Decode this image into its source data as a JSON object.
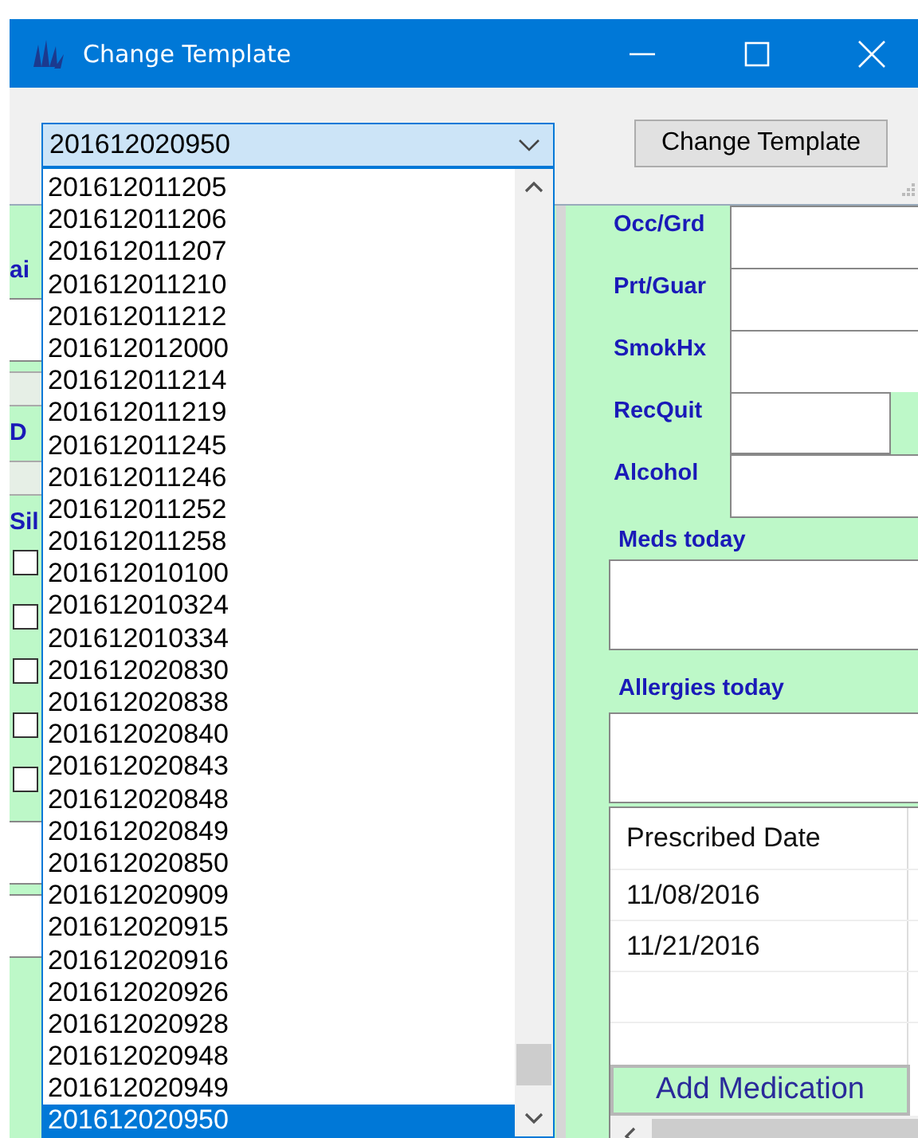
{
  "window": {
    "title": "Change Template"
  },
  "toolbar": {
    "template_select": {
      "value": "201612020950",
      "expanded": true
    },
    "change_button": "Change Template"
  },
  "dropdown_list": {
    "items": [
      {
        "label": "201612011205",
        "selected": false
      },
      {
        "label": "201612011206",
        "selected": false
      },
      {
        "label": "201612011207",
        "selected": false
      },
      {
        "label": "201612011210",
        "selected": false
      },
      {
        "label": "201612011212",
        "selected": false
      },
      {
        "label": "201612012000",
        "selected": false
      },
      {
        "label": "201612011214",
        "selected": false
      },
      {
        "label": "201612011219",
        "selected": false
      },
      {
        "label": "201612011245",
        "selected": false
      },
      {
        "label": "201612011246",
        "selected": false
      },
      {
        "label": "201612011252",
        "selected": false
      },
      {
        "label": "201612011258",
        "selected": false
      },
      {
        "label": "201612010100",
        "selected": false
      },
      {
        "label": "201612010324",
        "selected": false
      },
      {
        "label": "201612010334",
        "selected": false
      },
      {
        "label": "201612020830",
        "selected": false
      },
      {
        "label": "201612020838",
        "selected": false
      },
      {
        "label": "201612020840",
        "selected": false
      },
      {
        "label": "201612020843",
        "selected": false
      },
      {
        "label": "201612020848",
        "selected": false
      },
      {
        "label": "201612020849",
        "selected": false
      },
      {
        "label": "201612020850",
        "selected": false
      },
      {
        "label": "201612020909",
        "selected": false
      },
      {
        "label": "201612020915",
        "selected": false
      },
      {
        "label": "201612020916",
        "selected": false
      },
      {
        "label": "201612020926",
        "selected": false
      },
      {
        "label": "201612020928",
        "selected": false
      },
      {
        "label": "201612020948",
        "selected": false
      },
      {
        "label": "201612020949",
        "selected": false
      },
      {
        "label": "201612020950",
        "selected": true
      }
    ]
  },
  "background_form": {
    "left_fragments": [
      {
        "kind": "label",
        "text": "ai"
      },
      {
        "kind": "field"
      },
      {
        "kind": "grey"
      },
      {
        "kind": "label",
        "text": "D"
      },
      {
        "kind": "grey"
      },
      {
        "kind": "label",
        "text": "Sil"
      },
      {
        "kind": "checkbox",
        "checked": false
      },
      {
        "kind": "checkbox",
        "checked": false
      },
      {
        "kind": "checkbox",
        "checked": false
      },
      {
        "kind": "checkbox",
        "checked": false
      },
      {
        "kind": "checkbox",
        "checked": false
      },
      {
        "kind": "field"
      },
      {
        "kind": "field"
      }
    ],
    "fields": [
      {
        "label": "Occ/Grd",
        "kind": "text"
      },
      {
        "label": "Prt/Guar",
        "kind": "text"
      },
      {
        "label": "SmokHx",
        "kind": "text"
      },
      {
        "label": "RecQuit",
        "kind": "split"
      },
      {
        "label": "Alcohol",
        "kind": "text"
      }
    ],
    "meds_label": "Meds today",
    "allergies_label": "Allergies today",
    "medications_table": {
      "columns": [
        "Prescribed Date"
      ],
      "rows": [
        [
          "11/08/2016"
        ],
        [
          "11/21/2016"
        ]
      ]
    },
    "add_button": "Add Medication"
  }
}
